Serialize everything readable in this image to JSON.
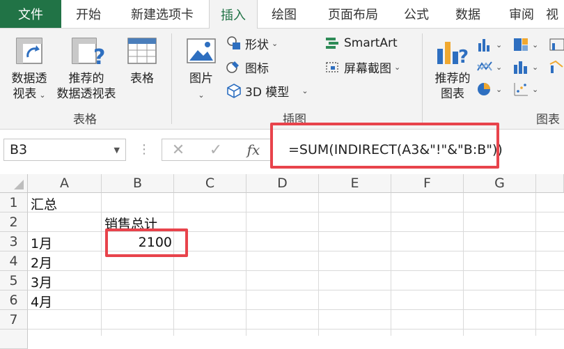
{
  "tabs": [
    "文件",
    "开始",
    "新建选项卡",
    "插入",
    "绘图",
    "页面布局",
    "公式",
    "数据",
    "审阅",
    "视"
  ],
  "ribbon": {
    "tables_group": {
      "label": "表格",
      "pivot_line1": "数据透",
      "pivot_line2": "视表",
      "recommended_pivot_line1": "推荐的",
      "recommended_pivot_line2": "数据透视表",
      "table": "表格"
    },
    "illustrations_group": {
      "label": "插图",
      "pictures": "图片",
      "shapes": "形状",
      "icons": "图标",
      "models3d": "3D 模型",
      "smartart": "SmartArt",
      "screenshot": "屏幕截图"
    },
    "charts_group": {
      "label": "图表",
      "recommended_line1": "推荐的",
      "recommended_line2": "图表"
    }
  },
  "formula_bar": {
    "name_box": "B3",
    "cancel": "✕",
    "enter": "✓",
    "fx": "fx",
    "formula": "=SUM(INDIRECT(A3&\"!\"&\"B:B\"))"
  },
  "grid": {
    "columns": [
      "A",
      "B",
      "C",
      "D",
      "E",
      "F",
      "G"
    ],
    "rows": [
      "1",
      "2",
      "3",
      "4",
      "5",
      "6",
      "7"
    ],
    "cells": {
      "A1": "汇总",
      "B2": "销售总计",
      "A3": "1月",
      "B3": "2100",
      "A4": "2月",
      "A5": "3月",
      "A6": "4月"
    }
  },
  "colors": {
    "excel_green": "#217346",
    "highlight_red": "#e8434b"
  }
}
